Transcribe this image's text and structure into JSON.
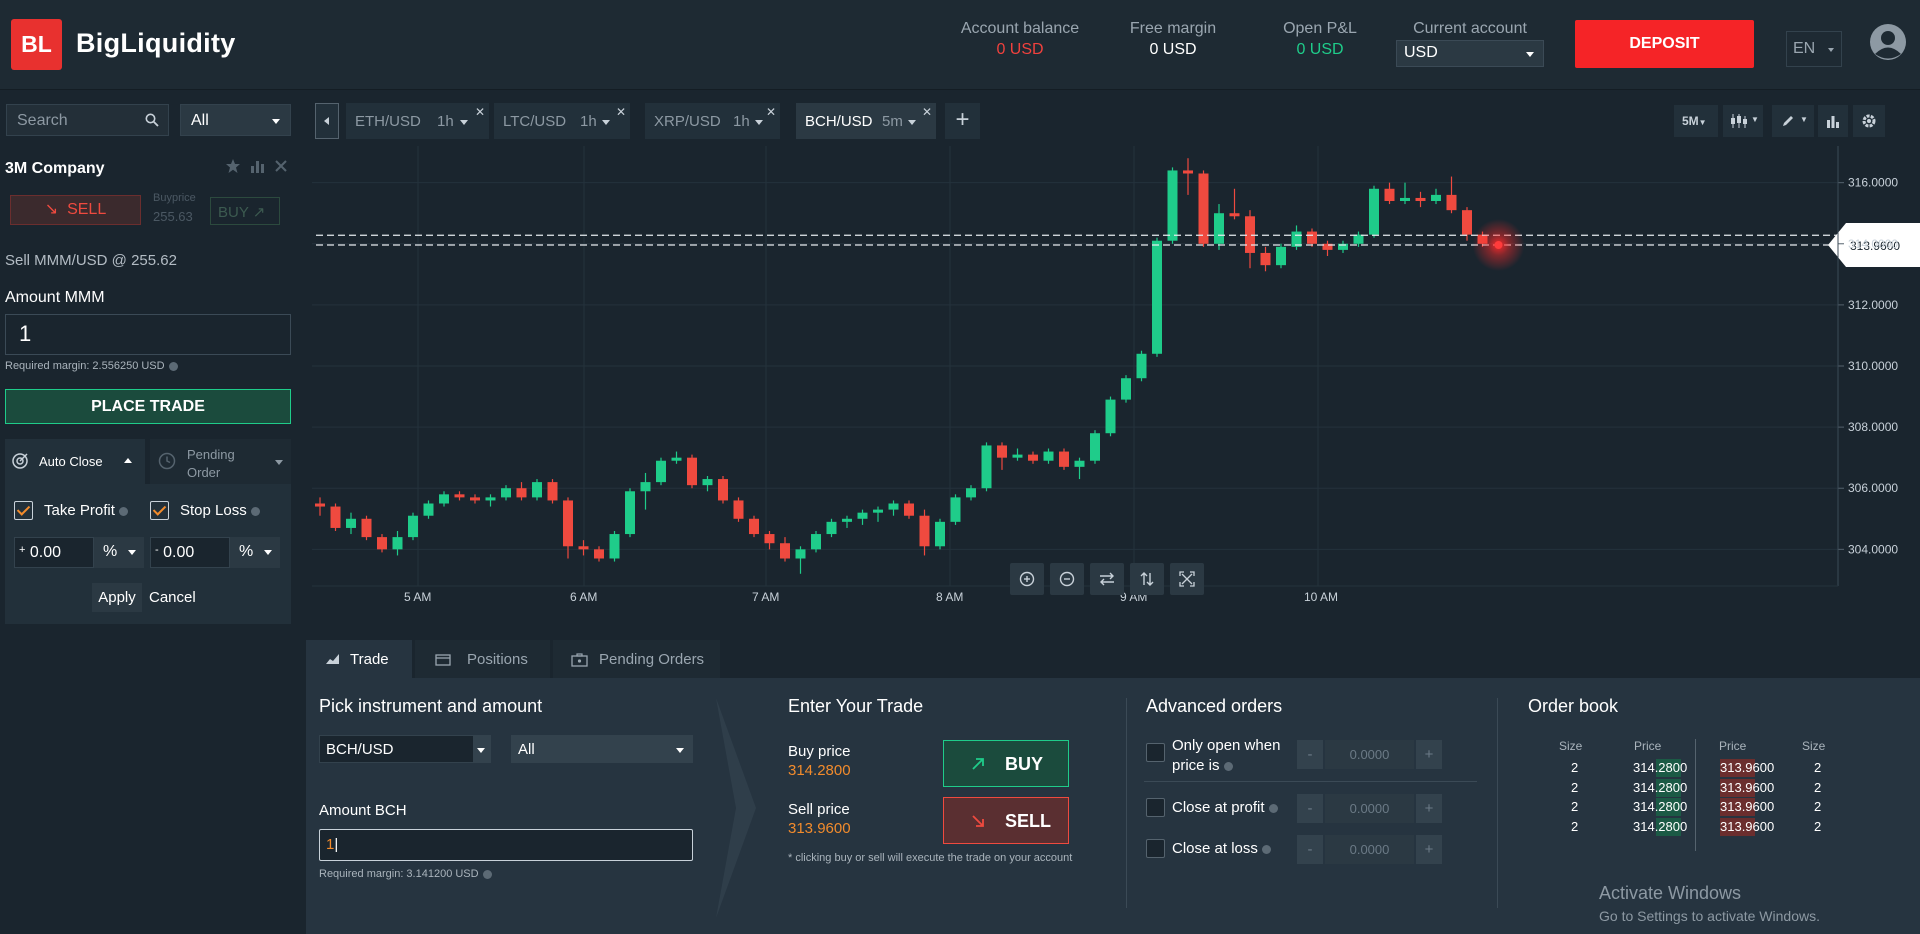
{
  "header": {
    "logo_text": "BL",
    "brand": "BigLiquidity",
    "account_balance_label": "Account balance",
    "account_balance_value": "0 USD",
    "free_margin_label": "Free margin",
    "free_margin_value": "0 USD",
    "open_pnl_label": "Open P&L",
    "open_pnl_value": "0 USD",
    "current_account_label": "Current account",
    "current_account_value": "USD",
    "deposit_label": "DEPOSIT",
    "language": "EN"
  },
  "left": {
    "search_placeholder": "Search",
    "filter_value": "All",
    "instrument_name": "3M Company",
    "sell_label": "SELL",
    "buyprice_label": "Buyprice",
    "buyprice_value": "255.63",
    "buy_label": "BUY",
    "sell_summary": "Sell MMM/USD @ 255.62",
    "amount_label": "Amount MMM",
    "amount_value": "1",
    "required_margin": "Required margin: 2.556250 USD",
    "place_trade": "PLACE TRADE",
    "auto_close_tab": "Auto Close",
    "pending_order_tab": "Pending Order",
    "take_profit": "Take Profit",
    "stop_loss": "Stop Loss",
    "tp_sign": "+",
    "tp_value": "0.00",
    "tp_unit": "%",
    "sl_sign": "-",
    "sl_value": "0.00",
    "sl_unit": "%",
    "apply": "Apply",
    "cancel": "Cancel"
  },
  "chart_tabs": [
    {
      "symbol": "ETH/USD",
      "timeframe": "1h"
    },
    {
      "symbol": "LTC/USD",
      "timeframe": "1h"
    },
    {
      "symbol": "XRP/USD",
      "timeframe": "1h"
    },
    {
      "symbol": "BCH/USD",
      "timeframe": "5m"
    }
  ],
  "chart_toolbar": {
    "interval": "5M"
  },
  "chart_data": {
    "type": "candlestick",
    "symbol": "BCH/USD",
    "x_ticks": [
      "5 AM",
      "6 AM",
      "7 AM",
      "8 AM",
      "9 AM",
      "10 AM"
    ],
    "y_ticks": [
      "304.0000",
      "306.0000",
      "308.0000",
      "310.0000",
      "312.0000",
      "314.0000",
      "316.0000"
    ],
    "ylim": [
      302.8,
      317.2
    ],
    "last_price_label": "313.9600",
    "bid_line": 314.28,
    "ask_line": 313.96,
    "candles": [
      [
        305.5,
        305.7,
        305.1,
        305.4
      ],
      [
        305.4,
        305.5,
        304.6,
        304.7
      ],
      [
        304.7,
        305.2,
        304.5,
        305.0
      ],
      [
        305.0,
        305.1,
        304.3,
        304.4
      ],
      [
        304.4,
        304.5,
        303.9,
        304.0
      ],
      [
        304.0,
        304.6,
        303.8,
        304.4
      ],
      [
        304.4,
        305.2,
        304.3,
        305.1
      ],
      [
        305.1,
        305.6,
        305.0,
        305.5
      ],
      [
        305.5,
        305.9,
        305.4,
        305.8
      ],
      [
        305.8,
        305.9,
        305.6,
        305.7
      ],
      [
        305.7,
        305.8,
        305.5,
        305.6
      ],
      [
        305.6,
        305.8,
        305.4,
        305.7
      ],
      [
        305.7,
        306.1,
        305.6,
        306.0
      ],
      [
        306.0,
        306.2,
        305.6,
        305.7
      ],
      [
        305.7,
        306.3,
        305.6,
        306.2
      ],
      [
        306.2,
        306.3,
        305.5,
        305.6
      ],
      [
        305.6,
        305.7,
        303.7,
        304.1
      ],
      [
        304.1,
        304.3,
        303.8,
        304.0
      ],
      [
        304.0,
        304.1,
        303.6,
        303.7
      ],
      [
        303.7,
        304.6,
        303.6,
        304.5
      ],
      [
        304.5,
        306.0,
        304.4,
        305.9
      ],
      [
        305.9,
        306.5,
        305.3,
        306.2
      ],
      [
        306.2,
        307.0,
        306.1,
        306.9
      ],
      [
        306.9,
        307.2,
        306.8,
        307.0
      ],
      [
        307.0,
        307.1,
        306.0,
        306.1
      ],
      [
        306.1,
        306.4,
        305.9,
        306.3
      ],
      [
        306.3,
        306.4,
        305.5,
        305.6
      ],
      [
        305.6,
        305.7,
        304.9,
        305.0
      ],
      [
        305.0,
        305.1,
        304.4,
        304.5
      ],
      [
        304.5,
        304.6,
        304.0,
        304.2
      ],
      [
        304.2,
        304.4,
        303.6,
        303.7
      ],
      [
        303.7,
        304.1,
        303.2,
        304.0
      ],
      [
        304.0,
        304.6,
        303.9,
        304.5
      ],
      [
        304.5,
        305.0,
        304.4,
        304.9
      ],
      [
        304.9,
        305.1,
        304.7,
        305.0
      ],
      [
        305.0,
        305.3,
        304.8,
        305.2
      ],
      [
        305.2,
        305.4,
        304.9,
        305.3
      ],
      [
        305.3,
        305.6,
        305.1,
        305.5
      ],
      [
        305.5,
        305.6,
        305.0,
        305.1
      ],
      [
        305.1,
        305.3,
        303.8,
        304.1
      ],
      [
        304.1,
        305.0,
        304.0,
        304.9
      ],
      [
        304.9,
        305.8,
        304.8,
        305.7
      ],
      [
        305.7,
        306.1,
        305.6,
        306.0
      ],
      [
        306.0,
        307.5,
        305.9,
        307.4
      ],
      [
        307.4,
        307.5,
        306.6,
        307.0
      ],
      [
        307.0,
        307.3,
        306.9,
        307.1
      ],
      [
        307.1,
        307.2,
        306.8,
        306.9
      ],
      [
        306.9,
        307.3,
        306.8,
        307.2
      ],
      [
        307.2,
        307.3,
        306.6,
        306.7
      ],
      [
        306.7,
        307.0,
        306.3,
        306.9
      ],
      [
        306.9,
        307.9,
        306.8,
        307.8
      ],
      [
        307.8,
        309.0,
        307.7,
        308.9
      ],
      [
        308.9,
        309.7,
        308.8,
        309.6
      ],
      [
        309.6,
        310.5,
        309.5,
        310.4
      ],
      [
        310.4,
        314.2,
        310.3,
        314.1
      ],
      [
        314.1,
        316.5,
        314.0,
        316.4
      ],
      [
        316.4,
        316.8,
        315.6,
        316.3
      ],
      [
        316.3,
        316.4,
        313.9,
        314.0
      ],
      [
        314.0,
        315.3,
        313.8,
        315.0
      ],
      [
        315.0,
        315.8,
        314.8,
        314.9
      ],
      [
        314.9,
        315.1,
        313.2,
        313.7
      ],
      [
        313.7,
        313.9,
        313.1,
        313.3
      ],
      [
        313.3,
        314.0,
        313.2,
        313.9
      ],
      [
        313.9,
        314.6,
        313.8,
        314.4
      ],
      [
        314.4,
        314.5,
        313.9,
        314.0
      ],
      [
        314.0,
        314.1,
        313.6,
        313.8
      ],
      [
        313.8,
        314.1,
        313.7,
        314.0
      ],
      [
        314.0,
        314.4,
        313.9,
        314.3
      ],
      [
        314.3,
        315.9,
        314.2,
        315.8
      ],
      [
        315.8,
        316.0,
        315.3,
        315.4
      ],
      [
        315.4,
        316.0,
        315.3,
        315.5
      ],
      [
        315.5,
        315.7,
        315.2,
        315.4
      ],
      [
        315.4,
        315.8,
        315.3,
        315.6
      ],
      [
        315.6,
        316.2,
        315.0,
        315.1
      ],
      [
        315.1,
        315.2,
        314.1,
        314.3
      ],
      [
        314.3,
        314.4,
        313.9,
        314.0
      ]
    ]
  },
  "bottom": {
    "tabs": [
      "Trade",
      "Positions",
      "Pending Orders"
    ],
    "pick_title": "Pick instrument and amount",
    "instrument_value": "BCH/USD",
    "filter_value": "All",
    "amount_label": "Amount BCH",
    "amount_value": "1",
    "required_margin": "Required margin: 3.141200 USD",
    "enter_title": "Enter Your Trade",
    "buy_price_label": "Buy price",
    "buy_price_value": "314.2800",
    "sell_price_label": "Sell price",
    "sell_price_value": "313.9600",
    "buy_btn": "BUY",
    "sell_btn": "SELL",
    "note": "* clicking buy or sell will execute the trade on your account",
    "adv_title": "Advanced orders",
    "adv_open_when": "Only open when price is",
    "adv_close_profit": "Close at profit",
    "adv_close_loss": "Close at loss",
    "stepper_value": "0.0000",
    "orderbook_title": "Order book",
    "ob_headers": [
      "Size",
      "Price",
      "Price",
      "Size"
    ],
    "ob_rows": [
      {
        "bid_size": "2",
        "bid_price": "314.2800",
        "ask_price": "313.9600",
        "ask_size": "2"
      },
      {
        "bid_size": "2",
        "bid_price": "314.2800",
        "ask_price": "313.9600",
        "ask_size": "2"
      },
      {
        "bid_size": "2",
        "bid_price": "314.2800",
        "ask_price": "313.9600",
        "ask_size": "2"
      },
      {
        "bid_size": "2",
        "bid_price": "314.2800",
        "ask_price": "313.9600",
        "ask_size": "2"
      }
    ],
    "watermark_title": "Activate Windows",
    "watermark_sub": "Go to Settings to activate Windows."
  },
  "colors": {
    "up": "#1fcc8a",
    "down": "#ef4a3f",
    "accent": "#f28b2c",
    "deposit": "#f52427"
  }
}
